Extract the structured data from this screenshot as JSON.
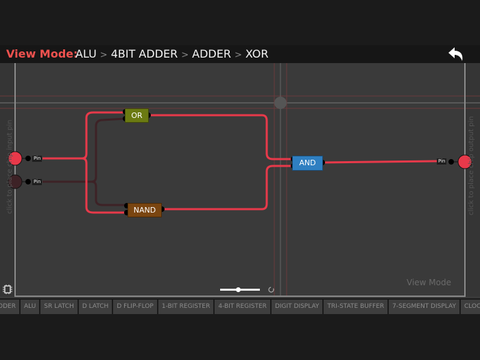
{
  "header": {
    "mode_label": "View Mode:",
    "breadcrumb": [
      "ALU",
      "4BIT ADDER",
      "ADDER",
      "XOR"
    ],
    "separator": ">",
    "back_icon": "undo-arrow-icon"
  },
  "canvas": {
    "input_hint": "click to place chip input pin",
    "output_hint": "click to place chip output pin",
    "mode_watermark": "View Mode",
    "inputs": [
      {
        "label": "Pin",
        "state": "on"
      },
      {
        "label": "Pin",
        "state": "off"
      }
    ],
    "outputs": [
      {
        "label": "Pin",
        "state": "on"
      }
    ],
    "gates": [
      {
        "label": "OR",
        "color": "#6b7a12"
      },
      {
        "label": "NAND",
        "color": "#7a4510"
      },
      {
        "label": "AND",
        "color": "#2f7fc1"
      }
    ],
    "wire_on_color": "#e8394a",
    "wire_off_color": "#3d2226",
    "zoom_level": 0.45
  },
  "toolbar": {
    "tabs": [
      "ODER",
      "ALU",
      "SR LATCH",
      "D LATCH",
      "D FLIP-FLOP",
      "1-BIT REGISTER",
      "4-BIT REGISTER",
      "DIGIT DISPLAY",
      "TRI-STATE BUFFER",
      "7-SEGMENT DISPLAY",
      "CLOCK"
    ]
  }
}
